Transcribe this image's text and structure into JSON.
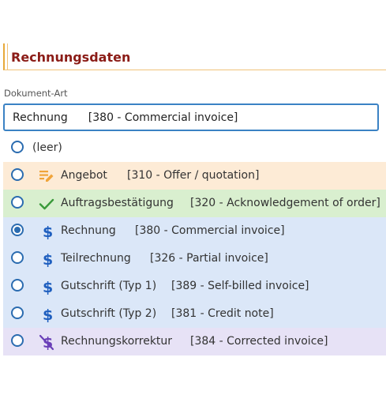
{
  "section": {
    "title": "Rechnungsdaten"
  },
  "field": {
    "label": "Dokument-Art",
    "selected_label": "Rechnung",
    "selected_code": "[380 - Commercial invoice]"
  },
  "options": [
    {
      "label": "(leer)",
      "code": "",
      "icon": "none",
      "bg": "#ffffff",
      "checked": false
    },
    {
      "label": "Angebot",
      "code": "[310 - Offer / quotation]",
      "icon": "edit-lines-icon",
      "bg": "#fdebd6",
      "checked": false
    },
    {
      "label": "Auftragsbestätigung",
      "code": "[320 - Acknowledgement of order]",
      "icon": "check-icon",
      "bg": "#d9efcf",
      "checked": false
    },
    {
      "label": "Rechnung",
      "code": "[380 - Commercial invoice]",
      "icon": "dollar-icon",
      "bg": "#dbe7f8",
      "checked": true
    },
    {
      "label": "Teilrechnung",
      "code": "[326 - Partial invoice]",
      "icon": "dollar-icon",
      "bg": "#dbe7f8",
      "checked": false
    },
    {
      "label": "Gutschrift (Typ 1)",
      "code": "[389 - Self-billed invoice]",
      "icon": "dollar-icon",
      "bg": "#dbe7f8",
      "checked": false
    },
    {
      "label": "Gutschrift (Typ 2)",
      "code": "[381 - Credit note]",
      "icon": "dollar-icon",
      "bg": "#dbe7f8",
      "checked": false
    },
    {
      "label": "Rechnungskorrektur",
      "code": "[384 - Corrected invoice]",
      "icon": "dollar-off-icon",
      "bg": "#e7e2f6",
      "checked": false
    }
  ],
  "colors": {
    "accent": "#2b6cb0",
    "header_text": "#8b1c17",
    "header_border": "#e7a93a",
    "edit_icon": "#f0a43a",
    "check_icon": "#3a9a3a",
    "dollar_icon": "#1f5fbf",
    "dollar_off_icon": "#6a3fb8"
  }
}
